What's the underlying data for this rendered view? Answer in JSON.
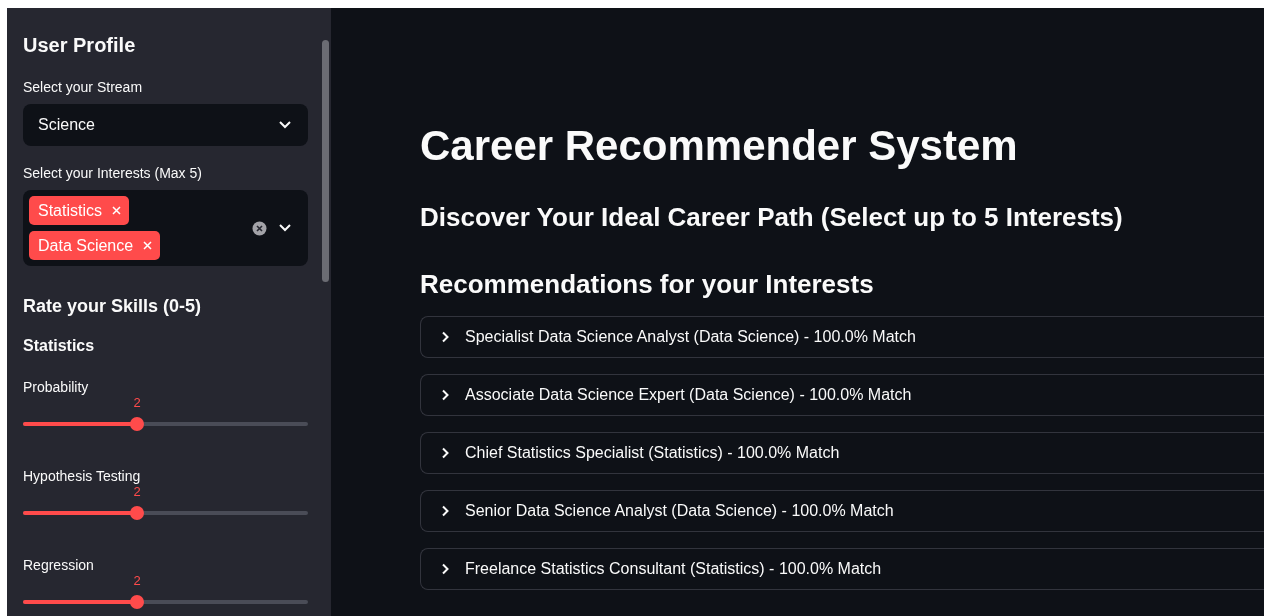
{
  "sidebar": {
    "title": "User Profile",
    "stream": {
      "label": "Select your Stream",
      "value": "Science"
    },
    "interests": {
      "label": "Select your Interests (Max 5)",
      "tags": [
        "Statistics",
        "Data Science"
      ]
    },
    "skills_heading": "Rate your Skills (0-5)",
    "skill_group": "Statistics",
    "sliders": [
      {
        "label": "Probability",
        "reading": "2",
        "level": 0.4
      },
      {
        "label": "Hypothesis Testing",
        "reading": "2",
        "level": 0.4
      },
      {
        "label": "Regression",
        "reading": "2",
        "level": 0.4
      }
    ]
  },
  "main": {
    "title": "Career Recommender System",
    "subtitle": "Discover Your Ideal Career Path (Select up to 5 Interests)",
    "section": "Recommendations for your Interests",
    "recommendations": [
      {
        "text": "Specialist Data Science Analyst (Data Science) - 100.0% Match",
        "expanded": false
      },
      {
        "text": "Associate Data Science Expert (Data Science) - 100.0% Match",
        "expanded": false
      },
      {
        "text": "Chief Statistics Specialist (Statistics) - 100.0% Match",
        "expanded": false
      },
      {
        "text": "Senior Data Science Analyst (Data Science) - 100.0% Match",
        "expanded": false
      },
      {
        "text": "Freelance Statistics Consultant (Statistics) - 100.0% Match",
        "expanded": false
      }
    ]
  }
}
